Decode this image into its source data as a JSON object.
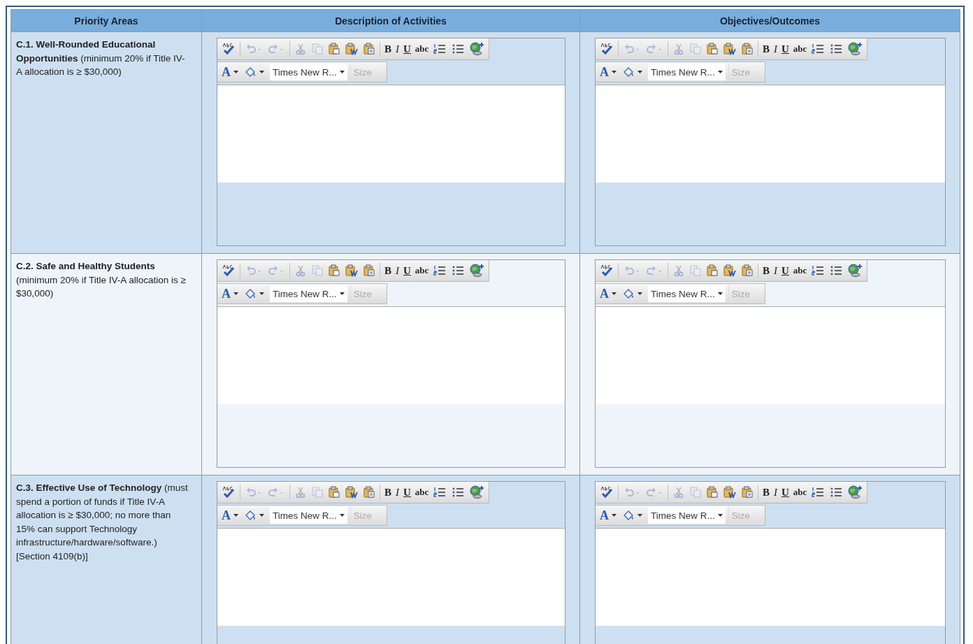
{
  "table": {
    "columns": [
      "Priority Areas",
      "Description of Activities",
      "Objectives/Outcomes"
    ],
    "rows": [
      {
        "area": "**C.1. Well-Rounded Educational Opportunities** (minimum 20% if Title IV-A allocation is ≥ $30,000)",
        "editors": [
          {
            "toolbar_groups": [
              [
                {
                  "kind": "spellcheck",
                  "disabled": false
                }
              ],
              [
                {
                  "kind": "undo",
                  "disabled": true
                },
                {
                  "kind": "redo",
                  "disabled": true
                }
              ],
              [
                {
                  "kind": "cut",
                  "disabled": true
                },
                {
                  "kind": "copy",
                  "disabled": true
                },
                {
                  "kind": "paste",
                  "disabled": false
                },
                {
                  "kind": "paste-word",
                  "disabled": false
                },
                {
                  "kind": "paste-text",
                  "disabled": false
                }
              ],
              [
                {
                  "kind": "bold",
                  "label": "B",
                  "disabled": false
                },
                {
                  "kind": "italic",
                  "label": "I",
                  "disabled": false
                },
                {
                  "kind": "underline",
                  "label": "U",
                  "disabled": false
                },
                {
                  "kind": "strike",
                  "label": "abc",
                  "disabled": false
                },
                {
                  "kind": "ordered-list",
                  "disabled": false
                },
                {
                  "kind": "bullet-list",
                  "disabled": false
                },
                {
                  "kind": "link",
                  "disabled": false
                }
              ]
            ],
            "font_tools": [
              {
                "kind": "font-color",
                "label": "A"
              },
              {
                "kind": "highlight"
              }
            ],
            "font_name": "Times New R...",
            "size_placeholder": "Size"
          },
          {
            "toolbar_groups": [
              [
                {
                  "kind": "spellcheck",
                  "disabled": false
                }
              ],
              [
                {
                  "kind": "undo",
                  "disabled": true
                },
                {
                  "kind": "redo",
                  "disabled": true
                }
              ],
              [
                {
                  "kind": "cut",
                  "disabled": true
                },
                {
                  "kind": "copy",
                  "disabled": true
                },
                {
                  "kind": "paste",
                  "disabled": false
                },
                {
                  "kind": "paste-word",
                  "disabled": false
                },
                {
                  "kind": "paste-text",
                  "disabled": false
                }
              ],
              [
                {
                  "kind": "bold",
                  "label": "B",
                  "disabled": false
                },
                {
                  "kind": "italic",
                  "label": "I",
                  "disabled": false
                },
                {
                  "kind": "underline",
                  "label": "U",
                  "disabled": false
                },
                {
                  "kind": "strike",
                  "label": "abc",
                  "disabled": false
                },
                {
                  "kind": "ordered-list",
                  "disabled": false
                },
                {
                  "kind": "bullet-list",
                  "disabled": false
                },
                {
                  "kind": "link",
                  "disabled": false
                }
              ]
            ],
            "font_tools": [
              {
                "kind": "font-color",
                "label": "A"
              },
              {
                "kind": "highlight"
              }
            ],
            "font_name": "Times New R...",
            "size_placeholder": "Size"
          }
        ]
      },
      {
        "area": "**C.2. Safe and Healthy Students** (minimum 20% if Title IV-A allocation is ≥ $30,000)",
        "editors": [
          {
            "toolbar_groups": [
              [
                {
                  "kind": "spellcheck",
                  "disabled": false
                }
              ],
              [
                {
                  "kind": "undo",
                  "disabled": true
                },
                {
                  "kind": "redo",
                  "disabled": true
                }
              ],
              [
                {
                  "kind": "cut",
                  "disabled": true
                },
                {
                  "kind": "copy",
                  "disabled": true
                },
                {
                  "kind": "paste",
                  "disabled": false
                },
                {
                  "kind": "paste-word",
                  "disabled": false
                },
                {
                  "kind": "paste-text",
                  "disabled": false
                }
              ],
              [
                {
                  "kind": "bold",
                  "label": "B",
                  "disabled": false
                },
                {
                  "kind": "italic",
                  "label": "I",
                  "disabled": false
                },
                {
                  "kind": "underline",
                  "label": "U",
                  "disabled": false
                },
                {
                  "kind": "strike",
                  "label": "abc",
                  "disabled": false
                },
                {
                  "kind": "ordered-list",
                  "disabled": false
                },
                {
                  "kind": "bullet-list",
                  "disabled": false
                },
                {
                  "kind": "link",
                  "disabled": false
                }
              ]
            ],
            "font_tools": [
              {
                "kind": "font-color",
                "label": "A"
              },
              {
                "kind": "highlight"
              }
            ],
            "font_name": "Times New R...",
            "size_placeholder": "Size"
          },
          {
            "toolbar_groups": [
              [
                {
                  "kind": "spellcheck",
                  "disabled": false
                }
              ],
              [
                {
                  "kind": "undo",
                  "disabled": true
                },
                {
                  "kind": "redo",
                  "disabled": true
                }
              ],
              [
                {
                  "kind": "cut",
                  "disabled": true
                },
                {
                  "kind": "copy",
                  "disabled": true
                },
                {
                  "kind": "paste",
                  "disabled": false
                },
                {
                  "kind": "paste-word",
                  "disabled": false
                },
                {
                  "kind": "paste-text",
                  "disabled": false
                }
              ],
              [
                {
                  "kind": "bold",
                  "label": "B",
                  "disabled": false
                },
                {
                  "kind": "italic",
                  "label": "I",
                  "disabled": false
                },
                {
                  "kind": "underline",
                  "label": "U",
                  "disabled": false
                },
                {
                  "kind": "strike",
                  "label": "abc",
                  "disabled": false
                },
                {
                  "kind": "ordered-list",
                  "disabled": false
                },
                {
                  "kind": "bullet-list",
                  "disabled": false
                },
                {
                  "kind": "link",
                  "disabled": false
                }
              ]
            ],
            "font_tools": [
              {
                "kind": "font-color",
                "label": "A"
              },
              {
                "kind": "highlight"
              }
            ],
            "font_name": "Times New R...",
            "size_placeholder": "Size"
          }
        ]
      },
      {
        "area": "**C.3. Effective Use of Technology** (must spend a portion of funds if Title IV-A allocation is ≥ $30,000; no more than 15% can support Technology infrastructure/hardware/software.) [Section 4109(b)]",
        "editors": [
          {
            "toolbar_groups": [
              [
                {
                  "kind": "spellcheck",
                  "disabled": false
                }
              ],
              [
                {
                  "kind": "undo",
                  "disabled": true
                },
                {
                  "kind": "redo",
                  "disabled": true
                }
              ],
              [
                {
                  "kind": "cut",
                  "disabled": true
                },
                {
                  "kind": "copy",
                  "disabled": true
                },
                {
                  "kind": "paste",
                  "disabled": false
                },
                {
                  "kind": "paste-word",
                  "disabled": false
                },
                {
                  "kind": "paste-text",
                  "disabled": false
                }
              ],
              [
                {
                  "kind": "bold",
                  "label": "B",
                  "disabled": false
                },
                {
                  "kind": "italic",
                  "label": "I",
                  "disabled": false
                },
                {
                  "kind": "underline",
                  "label": "U",
                  "disabled": false
                },
                {
                  "kind": "strike",
                  "label": "abc",
                  "disabled": false
                },
                {
                  "kind": "ordered-list",
                  "disabled": false
                },
                {
                  "kind": "bullet-list",
                  "disabled": false
                },
                {
                  "kind": "link",
                  "disabled": false
                }
              ]
            ],
            "font_tools": [
              {
                "kind": "font-color",
                "label": "A"
              },
              {
                "kind": "highlight"
              }
            ],
            "font_name": "Times New R...",
            "size_placeholder": "Size"
          },
          {
            "toolbar_groups": [
              [
                {
                  "kind": "spellcheck",
                  "disabled": false
                }
              ],
              [
                {
                  "kind": "undo",
                  "disabled": true
                },
                {
                  "kind": "redo",
                  "disabled": true
                }
              ],
              [
                {
                  "kind": "cut",
                  "disabled": true
                },
                {
                  "kind": "copy",
                  "disabled": true
                },
                {
                  "kind": "paste",
                  "disabled": false
                },
                {
                  "kind": "paste-word",
                  "disabled": false
                },
                {
                  "kind": "paste-text",
                  "disabled": false
                }
              ],
              [
                {
                  "kind": "bold",
                  "label": "B",
                  "disabled": false
                },
                {
                  "kind": "italic",
                  "label": "I",
                  "disabled": false
                },
                {
                  "kind": "underline",
                  "label": "U",
                  "disabled": false
                },
                {
                  "kind": "strike",
                  "label": "abc",
                  "disabled": false
                },
                {
                  "kind": "ordered-list",
                  "disabled": false
                },
                {
                  "kind": "bullet-list",
                  "disabled": false
                },
                {
                  "kind": "link",
                  "disabled": false
                }
              ]
            ],
            "font_tools": [
              {
                "kind": "font-color",
                "label": "A"
              },
              {
                "kind": "highlight"
              }
            ],
            "font_name": "Times New R...",
            "size_placeholder": "Size"
          }
        ]
      }
    ]
  }
}
